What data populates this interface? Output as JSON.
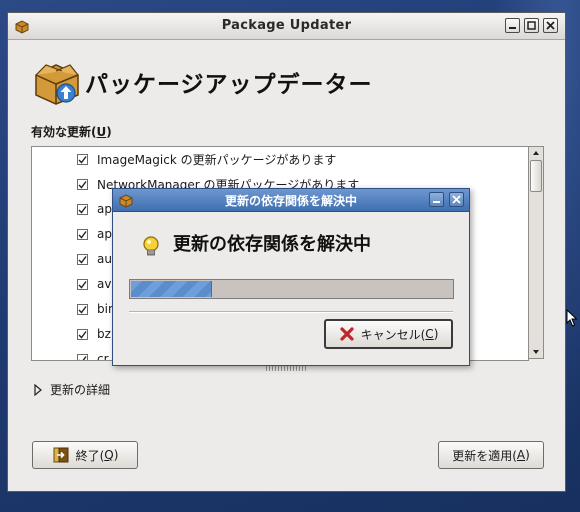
{
  "window": {
    "title": "Package Updater",
    "header_title": "パッケージアップデーター",
    "section_label_prefix": "有効な更新(",
    "section_label_key": "U",
    "section_label_suffix": ")",
    "updates": [
      "ImageMagick の更新パッケージがあります",
      "NetworkManager の更新パッケージがあります",
      "ap",
      "ap",
      "au",
      "av",
      "bin",
      "bz",
      "cr"
    ],
    "details_label": "更新の詳細",
    "quit_label_prefix": "終了(",
    "quit_key": "Q",
    "quit_label_suffix": ")",
    "apply_label_prefix": "更新を適用(",
    "apply_key": "A",
    "apply_label_suffix": ")"
  },
  "dialog": {
    "title": "更新の依存関係を解決中",
    "heading": "更新の依存関係を解決中",
    "progress": 0.25,
    "cancel_label_prefix": "キャンセル(",
    "cancel_key": "C",
    "cancel_label_suffix": ")"
  },
  "colors": {
    "accent": "#3f6fb1",
    "progress_fill": "#6f9fda",
    "desktop": "#1f3a72"
  },
  "icons": [
    "package-icon",
    "info-bulb-icon",
    "cancel-x-icon",
    "quit-icon",
    "checkmark-icon"
  ]
}
